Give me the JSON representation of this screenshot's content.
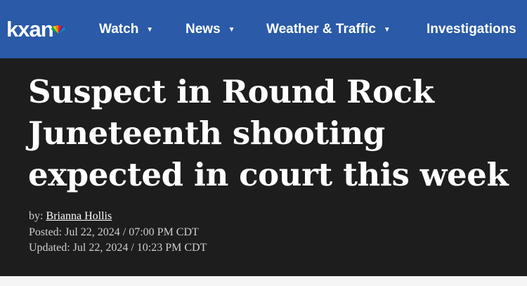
{
  "brand": {
    "logo_text": "kxan"
  },
  "nav": {
    "items": [
      {
        "label": "Watch",
        "has_dropdown": true
      },
      {
        "label": "News",
        "has_dropdown": true
      },
      {
        "label": "Weather & Traffic",
        "has_dropdown": true
      },
      {
        "label": "Investigations",
        "has_dropdown": false
      }
    ],
    "dropdown_icon": "chevron-down-icon"
  },
  "article": {
    "headline_lines": [
      "Suspect in Round Rock",
      "Juneteenth shooting",
      "expected in court this week"
    ],
    "byline_prefix": "by:",
    "author": "Brianna Hollis",
    "posted": "Posted: Jul 22, 2024 / 07:00 PM CDT",
    "updated": "Updated: Jul 22, 2024 / 10:23 PM CDT"
  },
  "colors": {
    "nav_background": "#2a5aa8",
    "article_background": "#1d1d1d",
    "headline_text": "#ffffff",
    "meta_text": "#cfcfcf"
  }
}
